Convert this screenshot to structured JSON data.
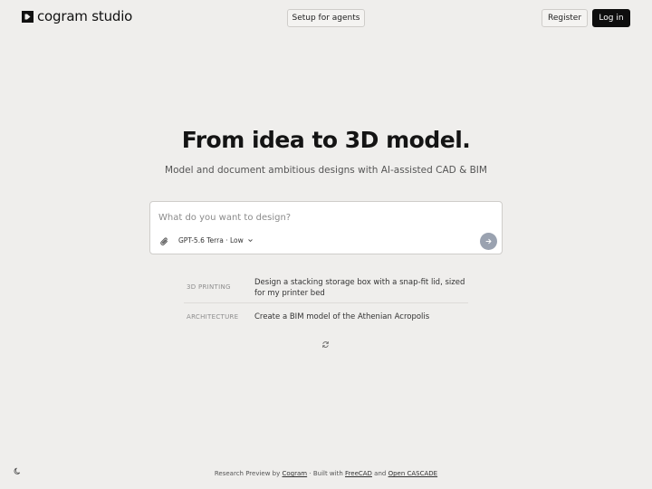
{
  "header": {
    "brand": "cogram studio",
    "agents_button": "Setup for agents",
    "register_button": "Register",
    "login_button": "Log in"
  },
  "hero": {
    "title": "From idea to 3D model.",
    "subtitle": "Model and document ambitious designs with AI-assisted CAD & BIM"
  },
  "prompt": {
    "placeholder": "What do you want to design?",
    "value": "",
    "model": "GPT-5.6 Terra · Low"
  },
  "suggestions": [
    {
      "category": "3D PRINTING",
      "text": "Design a stacking storage box with a snap-fit lid, sized for my printer bed"
    },
    {
      "category": "ARCHITECTURE",
      "text": "Create a BIM model of the Athenian Acropolis"
    }
  ],
  "footer": {
    "prefix": "Research Preview by",
    "cogram_link": "Cogram",
    "separator": "·",
    "built_with": "Built with",
    "freecad_link": "FreeCAD",
    "and": "and",
    "occ_link": "Open CASCADE"
  },
  "colors": {
    "background": "#efeeec",
    "login_bg": "#0e0e0e",
    "send_button": "#9aa2b0"
  },
  "icons": {
    "logo": "cogram-logo-icon",
    "attach": "paperclip-icon",
    "chevron": "chevron-down-icon",
    "send": "arrow-right-icon",
    "refresh": "refresh-icon",
    "theme": "moon-icon"
  }
}
